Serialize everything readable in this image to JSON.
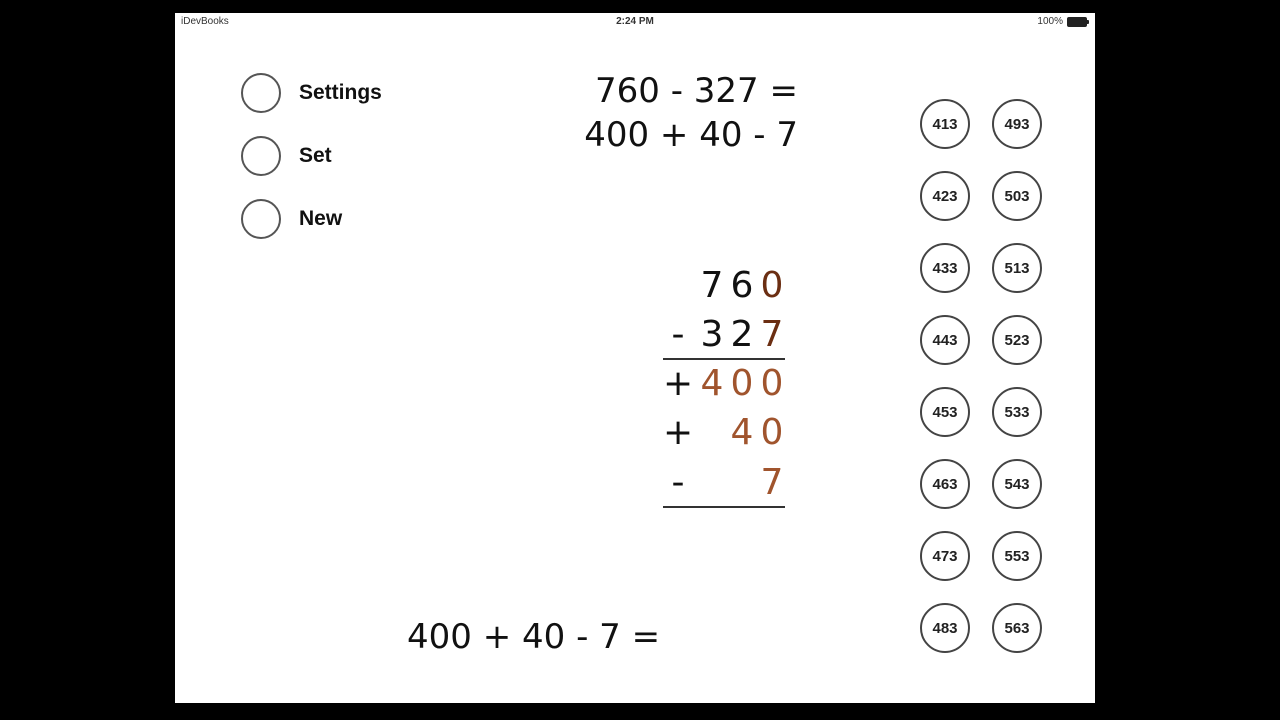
{
  "status_bar": {
    "carrier": "iDevBooks",
    "time": "2:24 PM",
    "battery": "100%"
  },
  "menu": {
    "items": [
      {
        "label": "Settings"
      },
      {
        "label": "Set"
      },
      {
        "label": "New"
      }
    ]
  },
  "problem": {
    "equation": "760 - 327 =",
    "decomposition": "400 + 40 - 7",
    "bottom_equation": "400 + 40 - 7 ="
  },
  "vertical": {
    "minuend": {
      "sign": "",
      "h": "7",
      "t": "6",
      "o": "0"
    },
    "subtrahend": {
      "sign": "-",
      "h": "3",
      "t": "2",
      "o": "7"
    },
    "hundreds_part": {
      "sign": "+",
      "h": "4",
      "t": "0",
      "o": "0"
    },
    "tens_part": {
      "sign": "+",
      "h": "",
      "t": "4",
      "o": "0"
    },
    "ones_part": {
      "sign": "-",
      "h": "",
      "t": "",
      "o": "7"
    }
  },
  "answers": {
    "left": [
      "413",
      "423",
      "433",
      "443",
      "453",
      "463",
      "473",
      "483"
    ],
    "right": [
      "493",
      "503",
      "513",
      "523",
      "533",
      "543",
      "553",
      "563"
    ]
  },
  "colors": {
    "highlight": "#a0542d",
    "text": "#111111",
    "background": "#ffffff",
    "frame": "#000000"
  }
}
